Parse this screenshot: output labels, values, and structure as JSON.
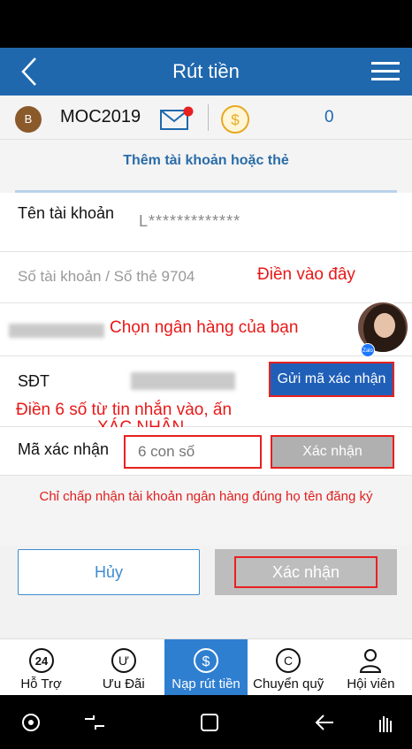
{
  "header": {
    "title": "Rút tiền"
  },
  "account": {
    "avatar_letter": "B",
    "username": "MOC2019",
    "balance": "0"
  },
  "form": {
    "add_tab_label": "Thêm tài khoản hoặc thẻ",
    "name_label": "Tên tài khoản",
    "name_value": "L*************",
    "account_number_placeholder": "Số tài khoản / Số thẻ 9704",
    "phone_label": "SĐT",
    "send_code_label": "Gửi mã xác nhận",
    "code_label": "Mã xác nhận",
    "code_placeholder": "6 con số",
    "code_confirm_label": "Xác nhận"
  },
  "annotations": {
    "fill_here": "Điền vào đây",
    "choose_bank": "Chọn ngân hàng của bạn",
    "enter_code_line1": "Điền 6 số từ tin nhắn vào, ấn",
    "enter_code_line2": "XÁC NHẬN"
  },
  "notice": "Chỉ chấp nhận tài khoản ngân hàng đúng họ tên đăng ký",
  "buttons": {
    "cancel": "Hủy",
    "confirm": "Xác nhận"
  },
  "chat": {
    "badge": "Zalo"
  },
  "bottom_nav": [
    {
      "label": "Hỗ Trợ",
      "icon": "support-24-icon"
    },
    {
      "label": "Ưu Đãi",
      "icon": "promo-icon"
    },
    {
      "label": "Nạp rút tiền",
      "icon": "dollar-icon",
      "active": true
    },
    {
      "label": "Chuyển quỹ",
      "icon": "transfer-icon"
    },
    {
      "label": "Hội viên",
      "icon": "user-icon"
    }
  ],
  "colors": {
    "brand": "#2068ad",
    "annotation": "#e81818",
    "active_tab": "#2f7fd1"
  }
}
